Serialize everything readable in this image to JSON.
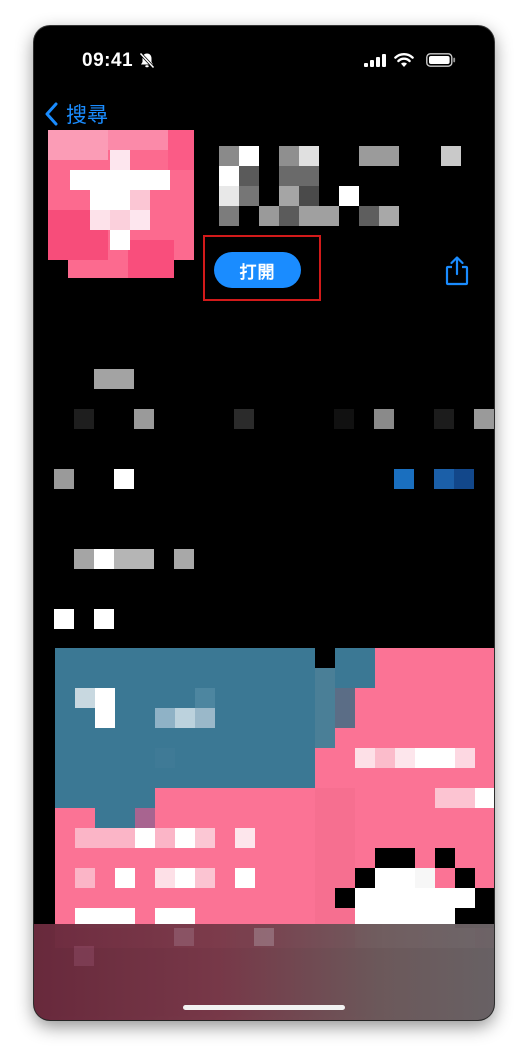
{
  "status_bar": {
    "time": "09:41",
    "icons": [
      "bell-off-icon",
      "signal-icon",
      "wifi-icon",
      "battery-icon"
    ]
  },
  "nav": {
    "back_label": "搜尋"
  },
  "app": {
    "open_button_label": "打開",
    "share_icon": "share-icon",
    "icon_colors": {
      "pink": "#f74d7a",
      "light_pink": "#fb9cb6",
      "white": "#ffffff"
    }
  },
  "colors": {
    "accent": "#1a8cff",
    "highlight": "#d21a1a",
    "background": "#000000",
    "preview_pink": "#fb7395",
    "preview_teal": "#3b7894"
  }
}
